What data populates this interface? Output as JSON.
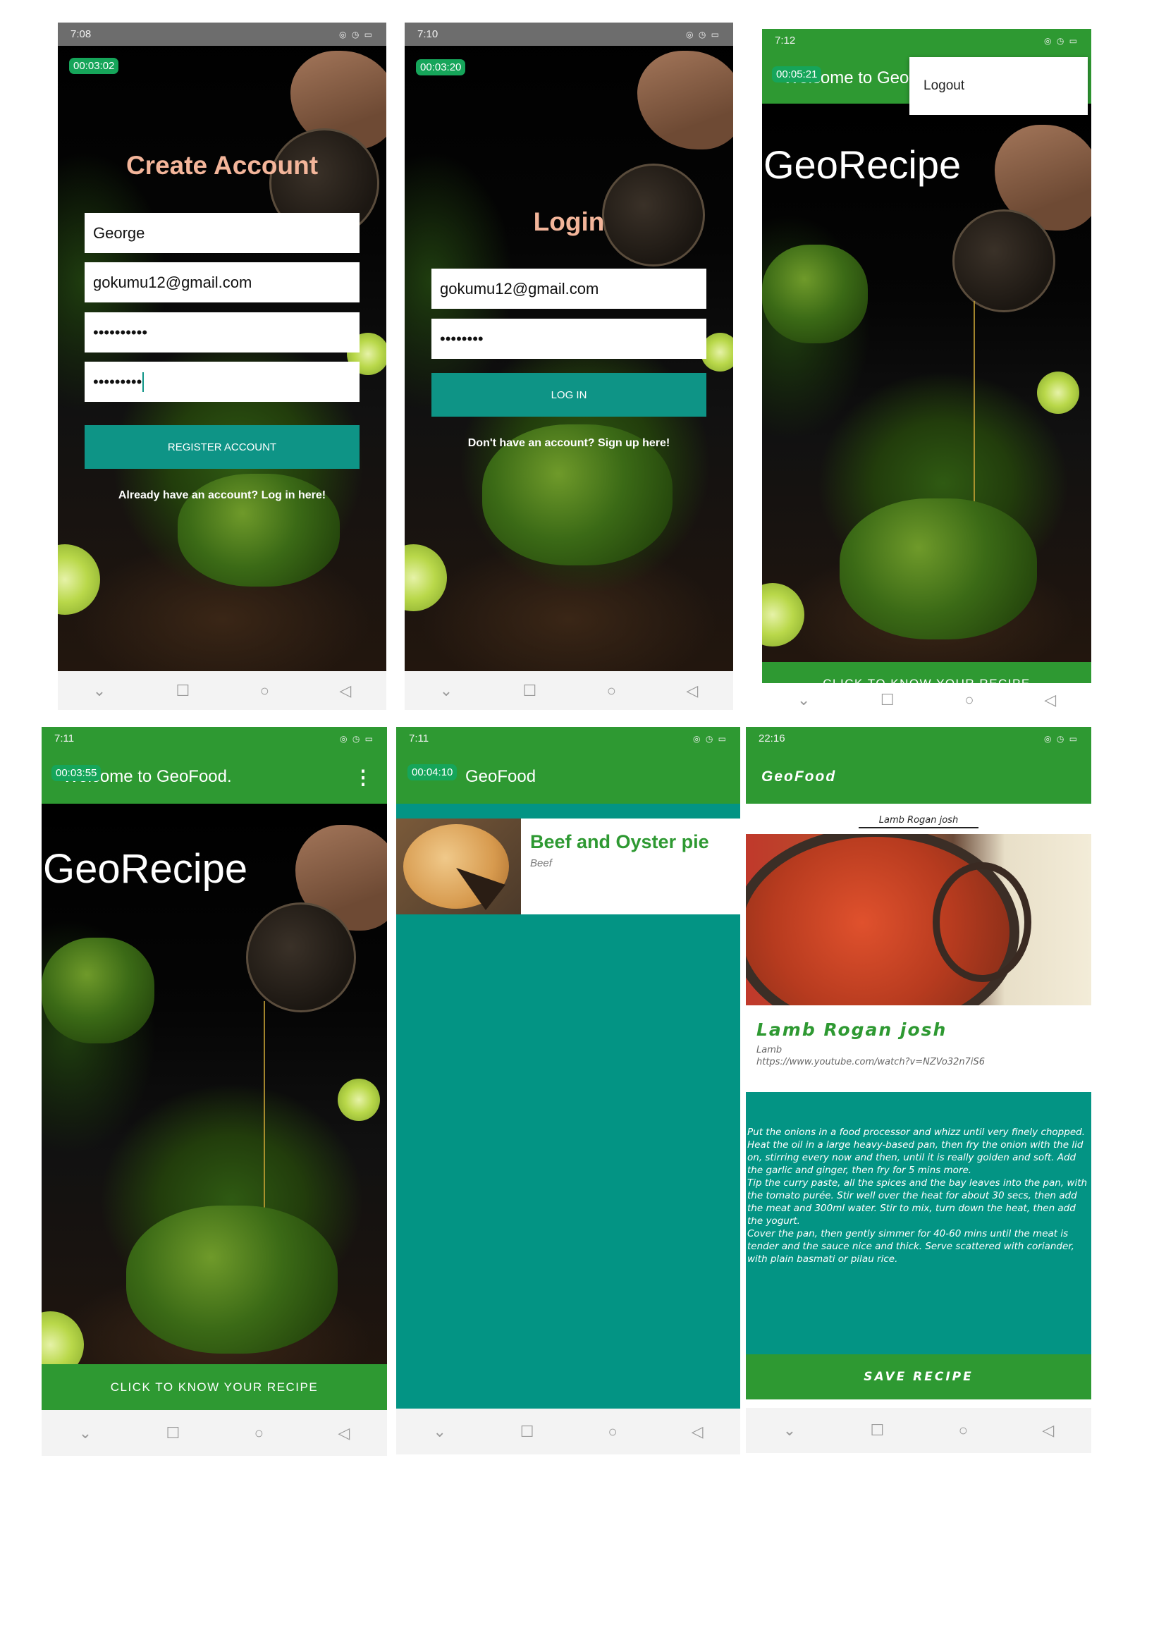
{
  "nav_icons": {
    "down": "⌄",
    "square": "☐",
    "circle": "○",
    "back": "◁"
  },
  "screen1": {
    "time": "7:08",
    "timer": "00:03:02",
    "title": "Create Account",
    "name_value": "George",
    "email_value": "gokumu12@gmail.com",
    "password_mask": "••••••••••",
    "confirm_mask": "•••••••••",
    "register_label": "REGISTER ACCOUNT",
    "login_link": "Already have an account? Log in here!"
  },
  "screen2": {
    "time": "7:10",
    "timer": "00:03:20",
    "title": "Login",
    "email_value": "gokumu12@gmail.com",
    "password_mask": "••••••••",
    "login_label": "LOG IN",
    "signup_link": "Don't have an account? Sign up here!"
  },
  "screen3": {
    "time": "7:12",
    "timer": "00:05:21",
    "appbar_title": "Welcome to GeoFood.",
    "menu_item": "Logout",
    "headline": "GeoRecipe",
    "cta_label": "CLICK TO KNOW YOUR RECIPE"
  },
  "screen4": {
    "time": "7:11",
    "timer": "00:03:55",
    "appbar_title": "Welcome to GeoFood.",
    "headline": "GeoRecipe",
    "cta_label": "CLICK TO KNOW YOUR RECIPE"
  },
  "screen5": {
    "time": "7:11",
    "timer": "00:04:10",
    "appbar_title": "GeoFood",
    "item_title": "Beef and Oyster pie",
    "item_category": "Beef"
  },
  "screen6": {
    "time": "22:16",
    "appbar_title": "GeoFood",
    "image_caption": "Lamb Rogan josh",
    "recipe_title": "Lamb Rogan josh",
    "recipe_category": "Lamb",
    "recipe_link": "https://www.youtube.com/watch?v=NZVo32n7iS6",
    "instructions_1": "Put the onions in a food processor and whizz until very finely chopped. Heat the oil in a large heavy-based pan, then fry the onion with the lid on, stirring every now and then, until it is really golden and soft. Add the garlic and ginger, then fry for 5 mins more.",
    "instructions_2": "Tip the curry paste, all the spices and the bay leaves into the pan, with the tomato purée. Stir well over the heat for about 30 secs, then add the meat and 300ml water. Stir to mix, turn down the heat, then add the yogurt.",
    "instructions_3": "Cover the pan, then gently simmer for 40-60 mins until the meat is tender and the sauce nice and thick. Serve scattered with coriander, with plain basmati or pilau rice.",
    "save_label": "SAVE RECIPE"
  }
}
